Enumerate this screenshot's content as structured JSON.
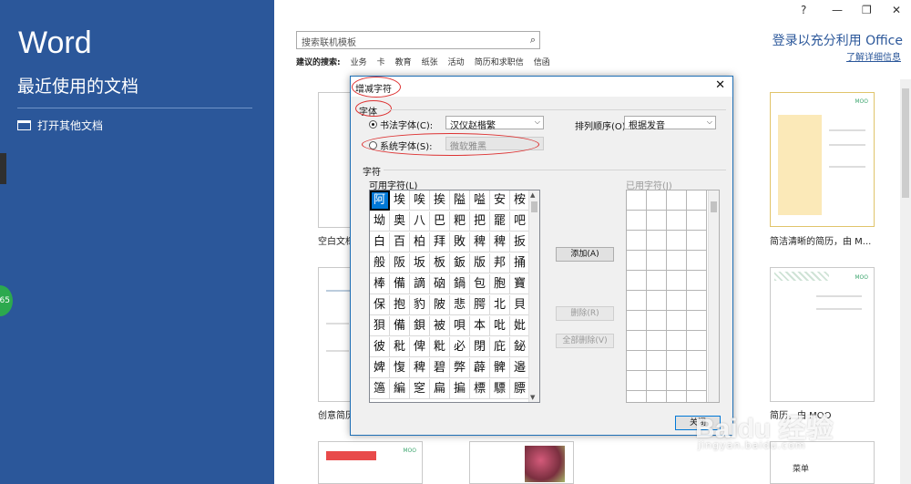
{
  "left_pane": {
    "app_title": "Word",
    "recent_heading": "最近使用的文档",
    "open_other": "打开其他文档",
    "side_badge": "65"
  },
  "window": {
    "help": "?",
    "minimize": "—",
    "restore": "❐",
    "close": "✕"
  },
  "main": {
    "search_placeholder": "搜索联机模板",
    "suggested_label": "建议的搜索:",
    "suggested": [
      "业务",
      "卡",
      "教育",
      "纸张",
      "活动",
      "简历和求职信",
      "信函"
    ],
    "signin": "登录以充分利用 Office",
    "learn_more": "了解详细信息",
    "thumb_labels": {
      "blank": "空白文档",
      "resume_clean": "简洁清晰的简历，由 M...",
      "creative": "创意简历",
      "resume_moo": "简历，由 MOO",
      "moo_tag": "MOO",
      "menu_title": "菜单"
    }
  },
  "dialog": {
    "title": "增减字符",
    "font_group": "字体",
    "calligraphy_label": "书法字体(C):",
    "calligraphy_value": "汉仪赵楷繁",
    "system_label": "系统字体(S):",
    "system_value": "微软雅黑",
    "sort_label": "排列顺序(O):",
    "sort_value": "根据发音",
    "chars_group": "字符",
    "available_label": "可用字符(L)",
    "used_label": "已用字符(J)",
    "chars": [
      "阿",
      "埃",
      "唉",
      "挨",
      "隘",
      "嗌",
      "安",
      "桉",
      "坳",
      "奥",
      "八",
      "巴",
      "粑",
      "把",
      "罷",
      "吧",
      "白",
      "百",
      "柏",
      "拜",
      "敗",
      "稗",
      "稗",
      "扳",
      "般",
      "阪",
      "坂",
      "板",
      "鈑",
      "版",
      "邦",
      "捅",
      "棒",
      "備",
      "謫",
      "硇",
      "鍋",
      "包",
      "胞",
      "寶",
      "保",
      "抱",
      "豹",
      "陂",
      "悲",
      "腭",
      "北",
      "貝",
      "狽",
      "備",
      "鋇",
      "被",
      "唄",
      "本",
      "吡",
      "妣",
      "彼",
      "秕",
      "俾",
      "粃",
      "必",
      "閉",
      "庇",
      "鉍",
      "婢",
      "愎",
      "稗",
      "碧",
      "弊",
      "薜",
      "髀",
      "邉",
      "簻",
      "編",
      "窆",
      "扁",
      "揙",
      "標",
      "驃",
      "膘"
    ],
    "add_button": "添加(A)",
    "remove_button": "删除(R)",
    "remove_all_button": "全部删除(V)",
    "close_button": "关闭"
  },
  "watermark": {
    "brand": "Baidu 经验",
    "url": "jingyan.baidu.com"
  }
}
